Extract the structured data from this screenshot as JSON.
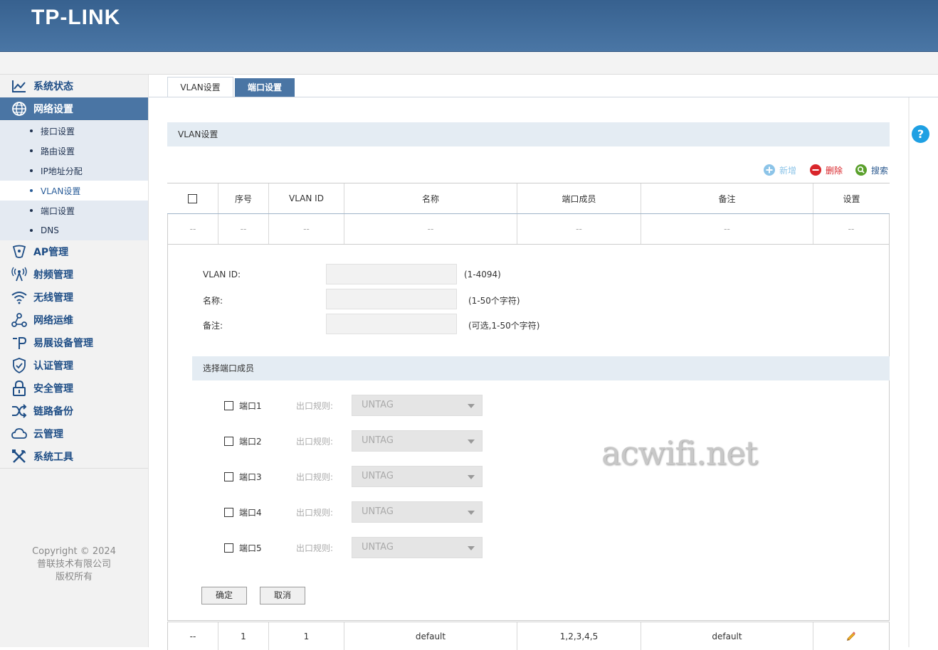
{
  "header": {
    "logo": "TP-LINK"
  },
  "sidebar": {
    "items": [
      {
        "label": "系统状态",
        "icon": "chart-line-icon"
      },
      {
        "label": "网络设置",
        "icon": "globe-icon"
      },
      {
        "label": "AP管理",
        "icon": "ap-icon"
      },
      {
        "label": "射频管理",
        "icon": "radio-icon"
      },
      {
        "label": "无线管理",
        "icon": "wifi-icon"
      },
      {
        "label": "网络运维",
        "icon": "network-ops-icon"
      },
      {
        "label": "易展设备管理",
        "icon": "mesh-device-icon"
      },
      {
        "label": "认证管理",
        "icon": "shield-check-icon"
      },
      {
        "label": "安全管理",
        "icon": "lock-icon"
      },
      {
        "label": "链路备份",
        "icon": "shuffle-icon"
      },
      {
        "label": "云管理",
        "icon": "cloud-icon"
      },
      {
        "label": "系统工具",
        "icon": "tools-icon"
      }
    ],
    "subitems": [
      {
        "label": "接口设置"
      },
      {
        "label": "路由设置"
      },
      {
        "label": "IP地址分配"
      },
      {
        "label": "VLAN设置"
      },
      {
        "label": "端口设置"
      },
      {
        "label": "DNS"
      }
    ],
    "copyright": [
      "Copyright © 2024",
      "普联技术有限公司",
      "版权所有"
    ]
  },
  "tabs": {
    "vlan": "VLAN设置",
    "port": "端口设置"
  },
  "help": "?",
  "section_title": "VLAN设置",
  "toolbar": {
    "add": "新增",
    "delete": "删除",
    "search": "搜索"
  },
  "table": {
    "headers": [
      "序号",
      "VLAN ID",
      "名称",
      "端口成员",
      "备注",
      "设置"
    ],
    "placeholder": "--",
    "row": {
      "check": "--",
      "index": "1",
      "vlan_id": "1",
      "name": "default",
      "members": "1,2,3,4,5",
      "note": "default"
    }
  },
  "form": {
    "vlan_id_label": "VLAN ID:",
    "vlan_id_hint": "(1-4094)",
    "name_label": "名称:",
    "name_hint": "(1-50个字符)",
    "note_label": "备注:",
    "note_hint": "(可选,1-50个字符)",
    "port_section": "选择端口成员",
    "rule_label": "出口规则:",
    "ports": [
      {
        "name": "端口1",
        "rule": "UNTAG"
      },
      {
        "name": "端口2",
        "rule": "UNTAG"
      },
      {
        "name": "端口3",
        "rule": "UNTAG"
      },
      {
        "name": "端口4",
        "rule": "UNTAG"
      },
      {
        "name": "端口5",
        "rule": "UNTAG"
      }
    ],
    "ok": "确定",
    "cancel": "取消"
  },
  "watermark": "acwifi.net",
  "colors": {
    "brand": "#4a75a4",
    "menu_text": "#1f4e86",
    "help": "#1fa0e3",
    "delete": "#d9252a",
    "search": "#5aa02c",
    "add": "#8cc4e8"
  }
}
